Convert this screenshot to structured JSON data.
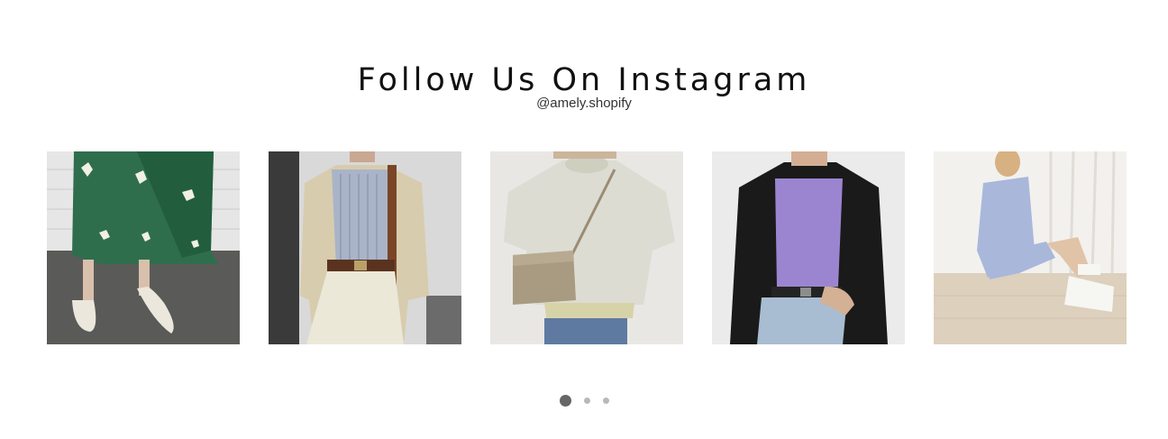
{
  "section": {
    "title": "Follow Us On Instagram",
    "handle": "@amely.shopify"
  },
  "posts": [
    {
      "subject": "green floral midi dress with white slingback flats"
    },
    {
      "subject": "beige blazer, striped shirt and cream trousers"
    },
    {
      "subject": "cream knit sweater with taupe crossbody bag"
    },
    {
      "subject": "black blazer over lilac tee with light jeans"
    },
    {
      "subject": "blue pajama set seated on wooden floor"
    }
  ],
  "carousel": {
    "page_count": 3,
    "active_index": 0
  },
  "colors": {
    "title": "#111111",
    "handle": "#333333",
    "dot_active": "#666666",
    "dot_inactive": "#b9b9b9"
  }
}
